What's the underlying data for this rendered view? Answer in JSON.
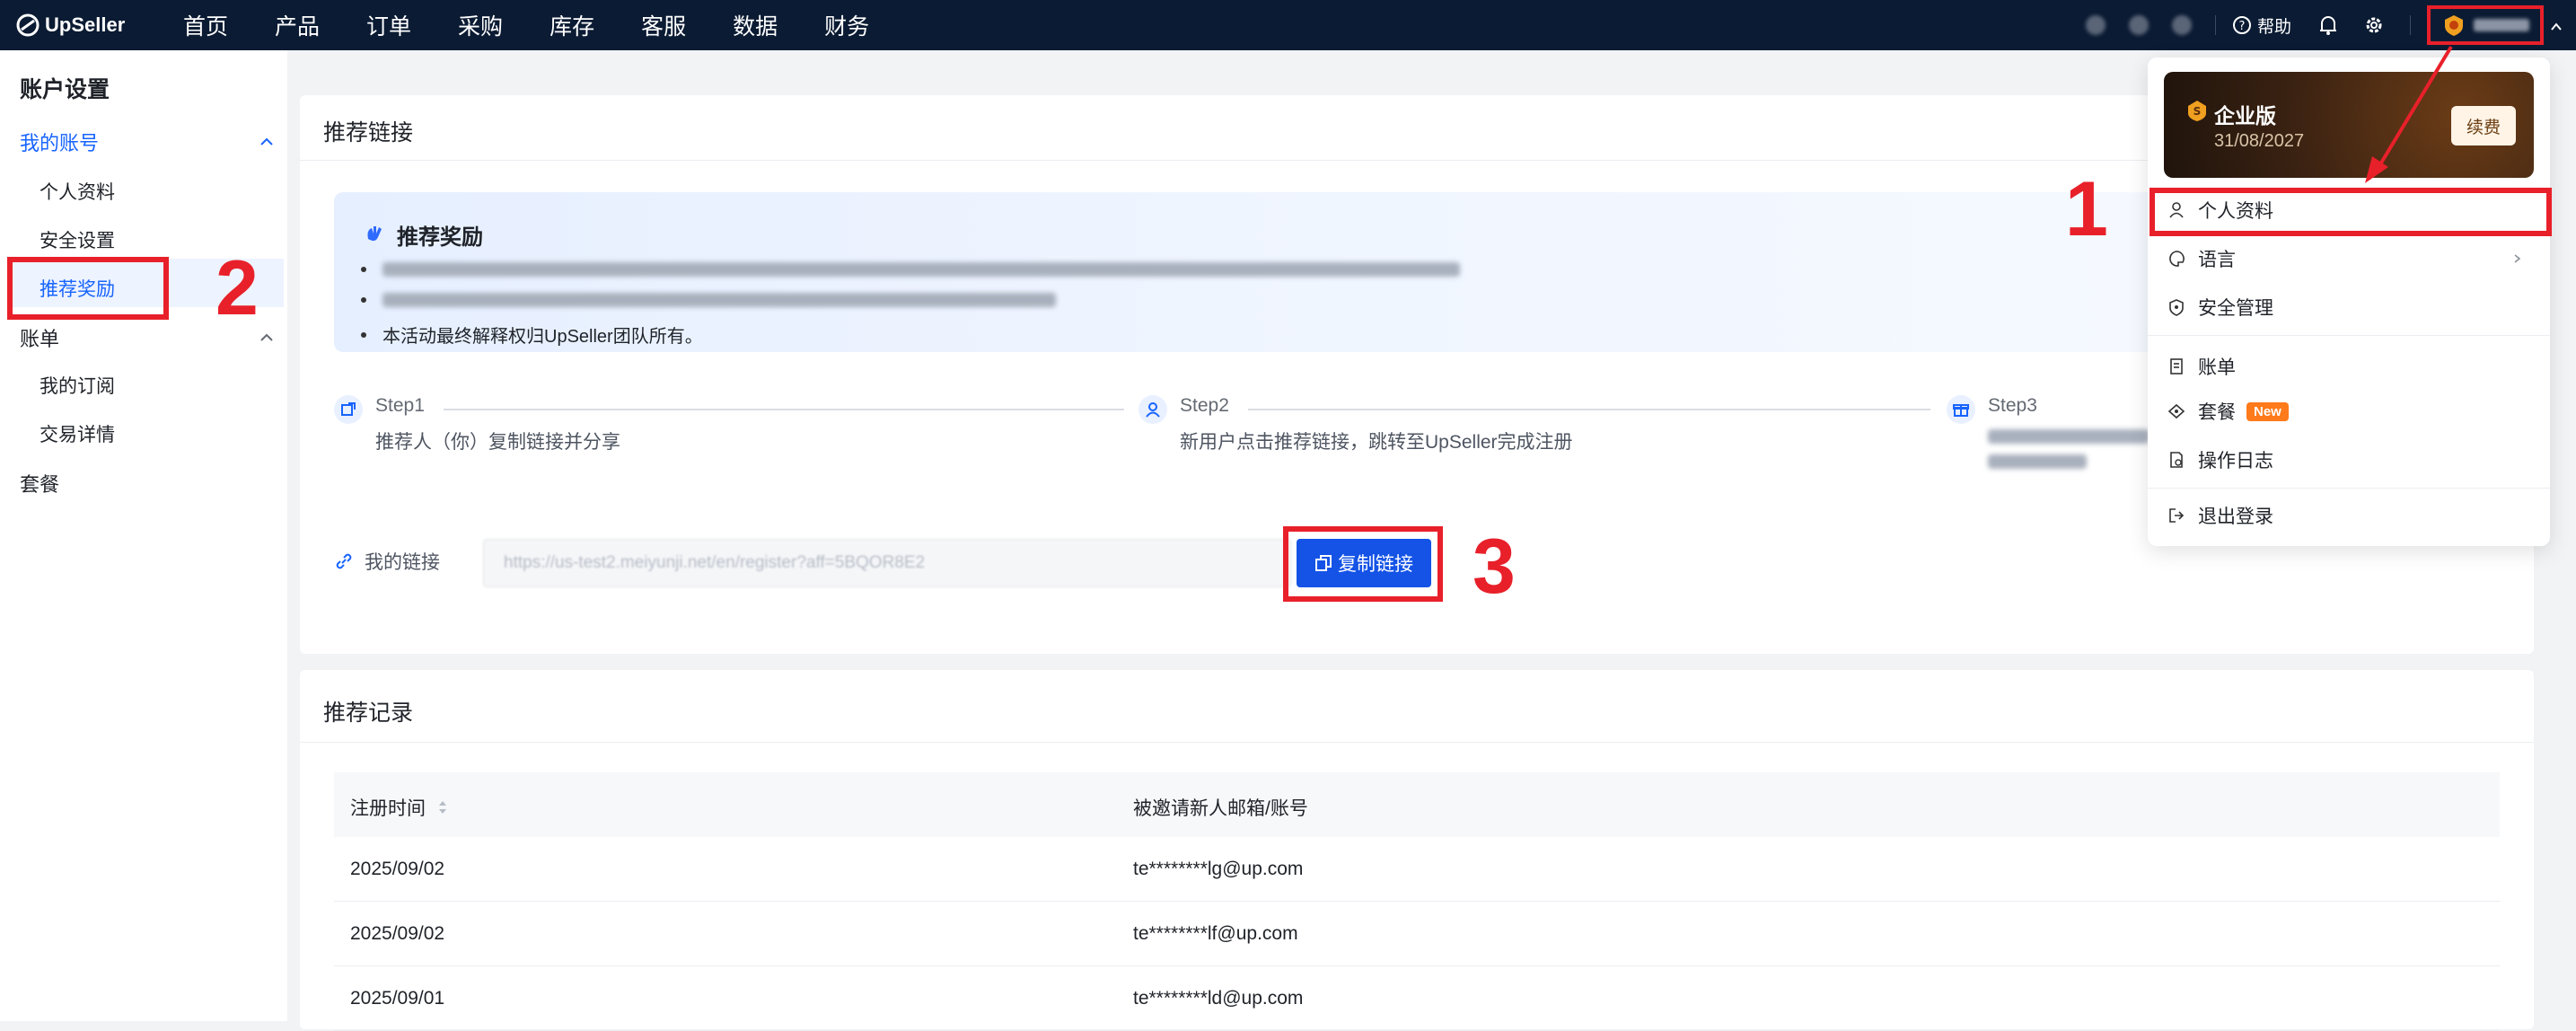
{
  "app": {
    "logo_text": "UpSeller"
  },
  "nav": {
    "menu": [
      "首页",
      "产品",
      "订单",
      "采购",
      "库存",
      "客服",
      "数据",
      "财务"
    ],
    "help_label": "帮助",
    "user_name": "test_xx"
  },
  "sidebar": {
    "title": "账户设置",
    "group_account": "我的账号",
    "items_account": [
      "个人资料",
      "安全设置",
      "推荐奖励"
    ],
    "group_bill": "账单",
    "items_bill": [
      "我的订阅",
      "交易详情"
    ],
    "group_plan": "套餐"
  },
  "referral": {
    "card_title": "推荐链接",
    "banner_title": "推荐奖励",
    "bullet3": "本活动最终解释权归UpSeller团队所有。",
    "steps": [
      {
        "label": "Step1",
        "desc": "推荐人（你）复制链接并分享"
      },
      {
        "label": "Step2",
        "desc": "新用户点击推荐链接，跳转至UpSeller完成注册"
      },
      {
        "label": "Step3",
        "desc": ""
      }
    ],
    "my_link_label": "我的链接",
    "link_value": "https://us-test2.meiyunji.net/en/register?aff=5BQOR8E2",
    "copy_button": "复制链接"
  },
  "records": {
    "card_title": "推荐记录",
    "columns": [
      "注册时间",
      "被邀请新人邮箱/账号"
    ],
    "rows": [
      [
        "2025/09/02",
        "te********lg@up.com"
      ],
      [
        "2025/09/02",
        "te********lf@up.com"
      ],
      [
        "2025/09/01",
        "te********ld@up.com"
      ]
    ]
  },
  "dropdown": {
    "plan_name": "企业版",
    "plan_expiry": "31/08/2027",
    "renew_button": "续费",
    "items": [
      "个人资料",
      "语言",
      "安全管理",
      "账单",
      "套餐",
      "操作日志",
      "退出登录"
    ],
    "new_badge": "New"
  },
  "annotations": {
    "n1": "1",
    "n2": "2",
    "n3": "3"
  },
  "colors": {
    "accent": "#1764ff",
    "nav_bg": "#0b1b33",
    "highlight": "#e8202a",
    "badge": "#ff7a1a"
  }
}
